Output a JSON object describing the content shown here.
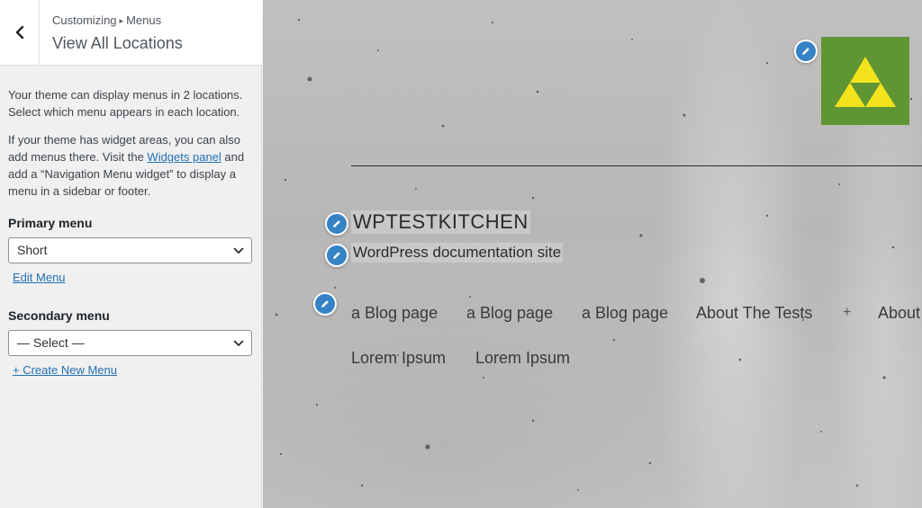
{
  "sidebar": {
    "breadcrumb_parent": "Customizing",
    "breadcrumb_separator": "▸",
    "breadcrumb_current": "Menus",
    "title": "View All Locations",
    "intro": "Your theme can display menus in 2 locations. Select which menu appears in each location.",
    "widgets_note_before": "If your theme has widget areas, you can also add menus there. Visit the ",
    "widgets_link": "Widgets panel",
    "widgets_note_after": " and add a “Navigation Menu widget” to display a menu in a sidebar or footer.",
    "primary": {
      "label": "Primary menu",
      "selected": "Short",
      "link": "Edit Menu"
    },
    "secondary": {
      "label": "Secondary menu",
      "selected": "— Select —",
      "link": "+ Create New Menu"
    }
  },
  "preview": {
    "site_title": "WPTESTKITCHEN",
    "tagline": "WordPress documentation site",
    "nav_row1": [
      "a Blog page",
      "a Blog page",
      "a Blog page",
      "About The Tests",
      "About"
    ],
    "nav_plus": "+",
    "nav_row2": [
      "Lorem Ipsum",
      "Lorem Ipsum"
    ],
    "logo_icon": "triforce-icon",
    "edit_icon": "pencil-icon",
    "colors": {
      "accent": "#3582c4",
      "link": "#2271b1",
      "logo_bg": "#5f9533",
      "logo_fg": "#f2e31c"
    }
  }
}
